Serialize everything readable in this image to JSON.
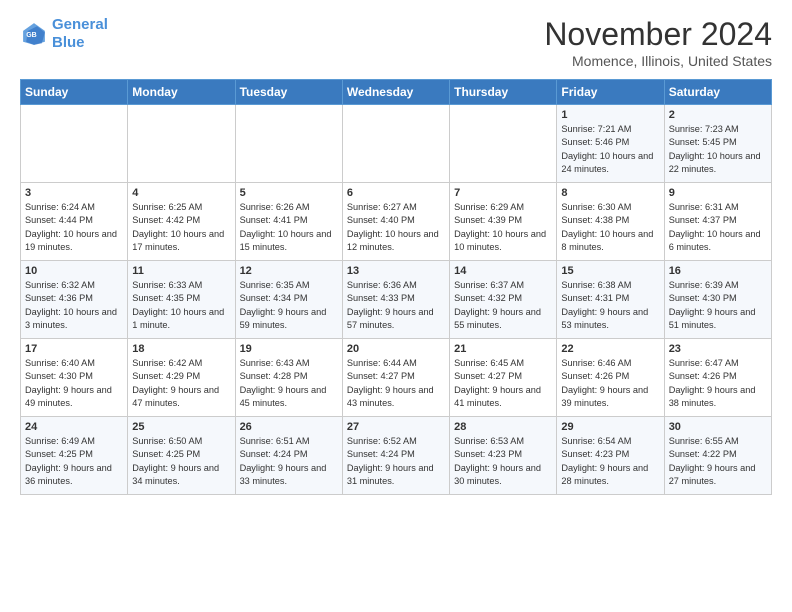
{
  "header": {
    "logo_line1": "General",
    "logo_line2": "Blue",
    "month": "November 2024",
    "location": "Momence, Illinois, United States"
  },
  "weekdays": [
    "Sunday",
    "Monday",
    "Tuesday",
    "Wednesday",
    "Thursday",
    "Friday",
    "Saturday"
  ],
  "weeks": [
    [
      {
        "day": "",
        "info": ""
      },
      {
        "day": "",
        "info": ""
      },
      {
        "day": "",
        "info": ""
      },
      {
        "day": "",
        "info": ""
      },
      {
        "day": "",
        "info": ""
      },
      {
        "day": "1",
        "info": "Sunrise: 7:21 AM\nSunset: 5:46 PM\nDaylight: 10 hours and 24 minutes."
      },
      {
        "day": "2",
        "info": "Sunrise: 7:23 AM\nSunset: 5:45 PM\nDaylight: 10 hours and 22 minutes."
      }
    ],
    [
      {
        "day": "3",
        "info": "Sunrise: 6:24 AM\nSunset: 4:44 PM\nDaylight: 10 hours and 19 minutes."
      },
      {
        "day": "4",
        "info": "Sunrise: 6:25 AM\nSunset: 4:42 PM\nDaylight: 10 hours and 17 minutes."
      },
      {
        "day": "5",
        "info": "Sunrise: 6:26 AM\nSunset: 4:41 PM\nDaylight: 10 hours and 15 minutes."
      },
      {
        "day": "6",
        "info": "Sunrise: 6:27 AM\nSunset: 4:40 PM\nDaylight: 10 hours and 12 minutes."
      },
      {
        "day": "7",
        "info": "Sunrise: 6:29 AM\nSunset: 4:39 PM\nDaylight: 10 hours and 10 minutes."
      },
      {
        "day": "8",
        "info": "Sunrise: 6:30 AM\nSunset: 4:38 PM\nDaylight: 10 hours and 8 minutes."
      },
      {
        "day": "9",
        "info": "Sunrise: 6:31 AM\nSunset: 4:37 PM\nDaylight: 10 hours and 6 minutes."
      }
    ],
    [
      {
        "day": "10",
        "info": "Sunrise: 6:32 AM\nSunset: 4:36 PM\nDaylight: 10 hours and 3 minutes."
      },
      {
        "day": "11",
        "info": "Sunrise: 6:33 AM\nSunset: 4:35 PM\nDaylight: 10 hours and 1 minute."
      },
      {
        "day": "12",
        "info": "Sunrise: 6:35 AM\nSunset: 4:34 PM\nDaylight: 9 hours and 59 minutes."
      },
      {
        "day": "13",
        "info": "Sunrise: 6:36 AM\nSunset: 4:33 PM\nDaylight: 9 hours and 57 minutes."
      },
      {
        "day": "14",
        "info": "Sunrise: 6:37 AM\nSunset: 4:32 PM\nDaylight: 9 hours and 55 minutes."
      },
      {
        "day": "15",
        "info": "Sunrise: 6:38 AM\nSunset: 4:31 PM\nDaylight: 9 hours and 53 minutes."
      },
      {
        "day": "16",
        "info": "Sunrise: 6:39 AM\nSunset: 4:30 PM\nDaylight: 9 hours and 51 minutes."
      }
    ],
    [
      {
        "day": "17",
        "info": "Sunrise: 6:40 AM\nSunset: 4:30 PM\nDaylight: 9 hours and 49 minutes."
      },
      {
        "day": "18",
        "info": "Sunrise: 6:42 AM\nSunset: 4:29 PM\nDaylight: 9 hours and 47 minutes."
      },
      {
        "day": "19",
        "info": "Sunrise: 6:43 AM\nSunset: 4:28 PM\nDaylight: 9 hours and 45 minutes."
      },
      {
        "day": "20",
        "info": "Sunrise: 6:44 AM\nSunset: 4:27 PM\nDaylight: 9 hours and 43 minutes."
      },
      {
        "day": "21",
        "info": "Sunrise: 6:45 AM\nSunset: 4:27 PM\nDaylight: 9 hours and 41 minutes."
      },
      {
        "day": "22",
        "info": "Sunrise: 6:46 AM\nSunset: 4:26 PM\nDaylight: 9 hours and 39 minutes."
      },
      {
        "day": "23",
        "info": "Sunrise: 6:47 AM\nSunset: 4:26 PM\nDaylight: 9 hours and 38 minutes."
      }
    ],
    [
      {
        "day": "24",
        "info": "Sunrise: 6:49 AM\nSunset: 4:25 PM\nDaylight: 9 hours and 36 minutes."
      },
      {
        "day": "25",
        "info": "Sunrise: 6:50 AM\nSunset: 4:25 PM\nDaylight: 9 hours and 34 minutes."
      },
      {
        "day": "26",
        "info": "Sunrise: 6:51 AM\nSunset: 4:24 PM\nDaylight: 9 hours and 33 minutes."
      },
      {
        "day": "27",
        "info": "Sunrise: 6:52 AM\nSunset: 4:24 PM\nDaylight: 9 hours and 31 minutes."
      },
      {
        "day": "28",
        "info": "Sunrise: 6:53 AM\nSunset: 4:23 PM\nDaylight: 9 hours and 30 minutes."
      },
      {
        "day": "29",
        "info": "Sunrise: 6:54 AM\nSunset: 4:23 PM\nDaylight: 9 hours and 28 minutes."
      },
      {
        "day": "30",
        "info": "Sunrise: 6:55 AM\nSunset: 4:22 PM\nDaylight: 9 hours and 27 minutes."
      }
    ]
  ]
}
